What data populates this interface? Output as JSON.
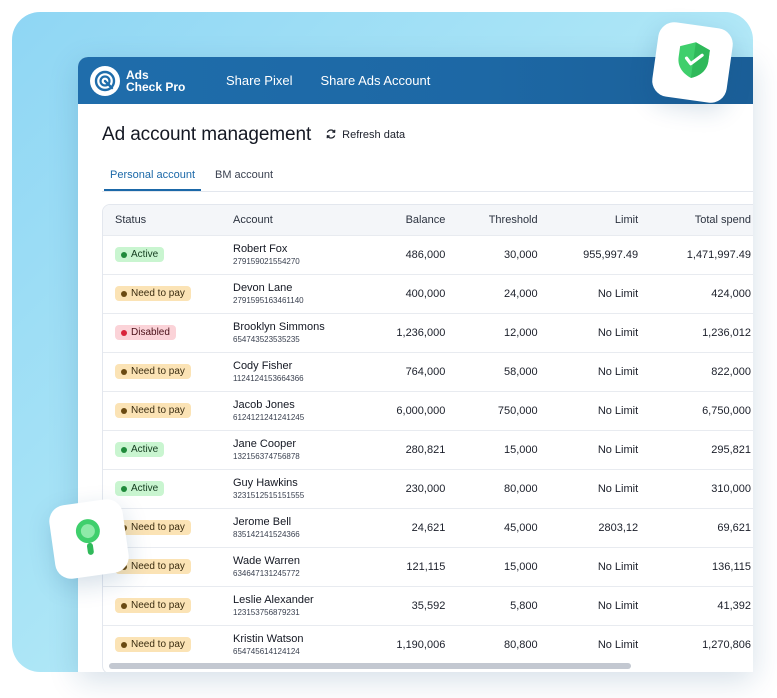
{
  "brand": {
    "line1": "Ads",
    "line2": "Check Pro"
  },
  "nav": {
    "share_pixel": "Share Pixel",
    "share_ads_account": "Share Ads Account"
  },
  "page": {
    "title": "Ad account management",
    "refresh_label": "Refresh data"
  },
  "tabs": [
    {
      "label": "Personal account",
      "active": true
    },
    {
      "label": "BM account",
      "active": false
    }
  ],
  "table": {
    "columns": [
      "Status",
      "Account",
      "Balance",
      "Threshold",
      "Limit",
      "Total spend"
    ],
    "rows": [
      {
        "status": "Active",
        "status_type": "active",
        "name": "Robert Fox",
        "id": "279159021554270",
        "balance": "486,000",
        "threshold": "30,000",
        "limit": "955,997.49",
        "total_spend": "1,471,997.49"
      },
      {
        "status": "Need to pay",
        "status_type": "pay",
        "name": "Devon Lane",
        "id": "2791595163461140",
        "balance": "400,000",
        "threshold": "24,000",
        "limit": "No Limit",
        "total_spend": "424,000"
      },
      {
        "status": "Disabled",
        "status_type": "disabled",
        "name": "Brooklyn Simmons",
        "id": "654743523535235",
        "balance": "1,236,000",
        "threshold": "12,000",
        "limit": "No Limit",
        "total_spend": "1,236,012"
      },
      {
        "status": "Need to pay",
        "status_type": "pay",
        "name": "Cody Fisher",
        "id": "1124124153664366",
        "balance": "764,000",
        "threshold": "58,000",
        "limit": "No Limit",
        "total_spend": "822,000"
      },
      {
        "status": "Need to pay",
        "status_type": "pay",
        "name": "Jacob Jones",
        "id": "6124121241241245",
        "balance": "6,000,000",
        "threshold": "750,000",
        "limit": "No Limit",
        "total_spend": "6,750,000"
      },
      {
        "status": "Active",
        "status_type": "active",
        "name": "Jane Cooper",
        "id": "132156374756878",
        "balance": "280,821",
        "threshold": "15,000",
        "limit": "No Limit",
        "total_spend": "295,821"
      },
      {
        "status": "Active",
        "status_type": "active",
        "name": "Guy Hawkins",
        "id": "3231512515151555",
        "balance": "230,000",
        "threshold": "80,000",
        "limit": "No Limit",
        "total_spend": "310,000"
      },
      {
        "status": "Need to pay",
        "status_type": "pay",
        "name": "Jerome Bell",
        "id": "835142141524366",
        "balance": "24,621",
        "threshold": "45,000",
        "limit": "2803,12",
        "total_spend": "69,621"
      },
      {
        "status": "Need to pay",
        "status_type": "pay",
        "name": "Wade Warren",
        "id": "634647131245772",
        "balance": "121,115",
        "threshold": "15,000",
        "limit": "No Limit",
        "total_spend": "136,115"
      },
      {
        "status": "Need to pay",
        "status_type": "pay",
        "name": "Leslie Alexander",
        "id": "123153756879231",
        "balance": "35,592",
        "threshold": "5,800",
        "limit": "No Limit",
        "total_spend": "41,392"
      },
      {
        "status": "Need to pay",
        "status_type": "pay",
        "name": "Kristin Watson",
        "id": "654745614124124",
        "balance": "1,190,006",
        "threshold": "80,800",
        "limit": "No Limit",
        "total_spend": "1,270,806"
      }
    ]
  },
  "icons": {
    "logo": "brand-logo-icon",
    "refresh": "refresh-icon",
    "shield": "shield-check-icon",
    "search": "search-icon"
  },
  "colors": {
    "header": "#1f6dab",
    "accent": "#1b68a8",
    "active_badge": "#c9f5d0",
    "pay_badge": "#fbe3b5",
    "disabled_badge": "#fbd3d8",
    "icon_green": "#3fcf6c"
  }
}
